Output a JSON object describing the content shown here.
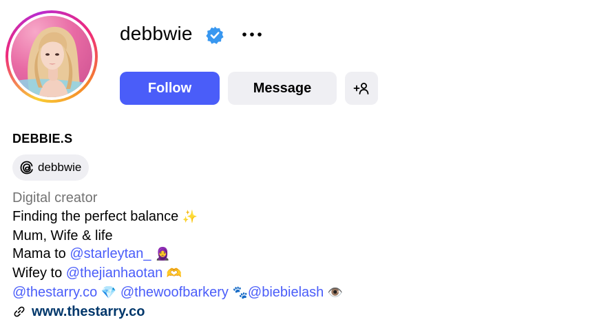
{
  "profile": {
    "username": "debbwie",
    "verified": true,
    "full_name": "DEBBIE.S",
    "threads_handle": "debbwie",
    "category": "Digital creator"
  },
  "actions": {
    "follow_label": "Follow",
    "message_label": "Message",
    "suggest_icon": "person-plus-icon",
    "more_icon": "more-horizontal-icon"
  },
  "bio": {
    "line1_text": "Finding the perfect balance",
    "line1_emoji": "✨",
    "line2_text": "Mum, Wife & life",
    "line3_prefix": "Mama to ",
    "line3_mention": "@starleytan_",
    "line3_emoji": "🧕",
    "line4_prefix": "Wifey to ",
    "line4_mention": "@thejianhaotan",
    "line4_emoji": "🫶",
    "line5_mention1": "@thestarry.co",
    "line5_emoji1": "💎",
    "line5_mention2": "@thewoofbarkery",
    "line5_emoji2": "🐾",
    "line5_mention3": "@biebielash",
    "line5_emoji3": "👁️"
  },
  "link": {
    "text": "www.thestarry.co",
    "icon": "link-icon"
  },
  "colors": {
    "accent": "#4a5df9",
    "secondary_button": "#efeff3",
    "verified_badge": "#3897f0",
    "link_text": "#00376b",
    "category_text": "#737373"
  }
}
